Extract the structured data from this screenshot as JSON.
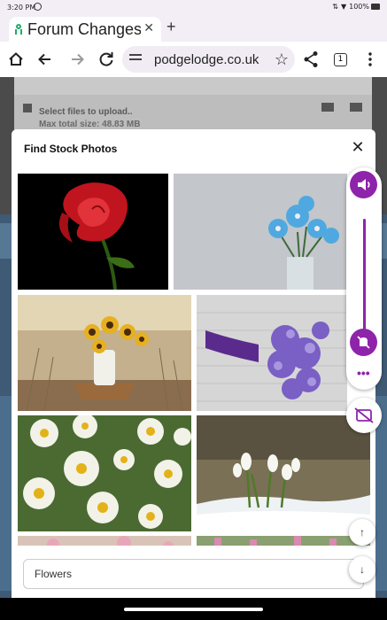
{
  "status_bar": {
    "time": "3:20 PM",
    "battery": "100%"
  },
  "browser": {
    "tab_title": "Forum Changes",
    "tab_close": "✕",
    "new_tab": "+",
    "url": "podgelodge.co.uk",
    "tab_count": "1"
  },
  "background_page": {
    "upload_title": "Select files to upload..",
    "upload_size": "Max total size: 48.83 MB"
  },
  "modal": {
    "title": "Find Stock Photos",
    "close": "✕",
    "search_value": "Flowers",
    "photos": [
      {
        "subject": "red rose on black",
        "color": "#c0141e"
      },
      {
        "subject": "blue hepatica flowers in glass",
        "color": "#4fa9e0"
      },
      {
        "subject": "sunflowers in vase on basket",
        "color": "#e6b020"
      },
      {
        "subject": "purple bouquet on wicker",
        "color": "#7a5fc4"
      },
      {
        "subject": "white daisies",
        "color": "#f2f2e8"
      },
      {
        "subject": "snowdrops in snow",
        "color": "#eef2f5"
      },
      {
        "subject": "pink blossoms",
        "color": "#e9a6b9"
      },
      {
        "subject": "pink heather",
        "color": "#d98ab0"
      }
    ]
  },
  "volume_panel": {
    "accent": "#8e24aa"
  },
  "fabs": {
    "up": "↑",
    "down": "↓"
  }
}
